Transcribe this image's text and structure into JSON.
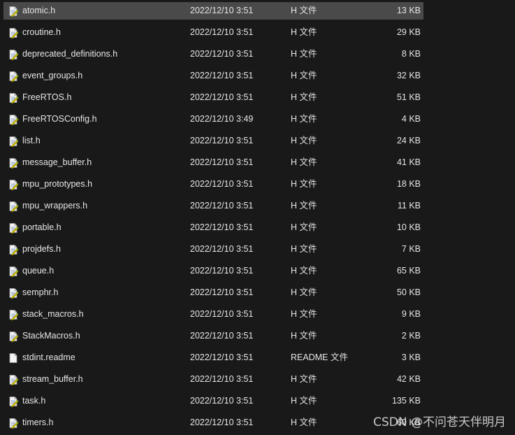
{
  "files": [
    {
      "name": "atomic.h",
      "date": "2022/12/10 3:51",
      "type": "H 文件",
      "size": "13 KB",
      "icon": "h-file-icon",
      "selected": true
    },
    {
      "name": "croutine.h",
      "date": "2022/12/10 3:51",
      "type": "H 文件",
      "size": "29 KB",
      "icon": "h-file-icon"
    },
    {
      "name": "deprecated_definitions.h",
      "date": "2022/12/10 3:51",
      "type": "H 文件",
      "size": "8 KB",
      "icon": "h-file-icon"
    },
    {
      "name": "event_groups.h",
      "date": "2022/12/10 3:51",
      "type": "H 文件",
      "size": "32 KB",
      "icon": "h-file-icon"
    },
    {
      "name": "FreeRTOS.h",
      "date": "2022/12/10 3:51",
      "type": "H 文件",
      "size": "51 KB",
      "icon": "h-file-icon"
    },
    {
      "name": "FreeRTOSConfig.h",
      "date": "2022/12/10 3:49",
      "type": "H 文件",
      "size": "4 KB",
      "icon": "h-file-icon"
    },
    {
      "name": "list.h",
      "date": "2022/12/10 3:51",
      "type": "H 文件",
      "size": "24 KB",
      "icon": "h-file-icon"
    },
    {
      "name": "message_buffer.h",
      "date": "2022/12/10 3:51",
      "type": "H 文件",
      "size": "41 KB",
      "icon": "h-file-icon"
    },
    {
      "name": "mpu_prototypes.h",
      "date": "2022/12/10 3:51",
      "type": "H 文件",
      "size": "18 KB",
      "icon": "h-file-icon"
    },
    {
      "name": "mpu_wrappers.h",
      "date": "2022/12/10 3:51",
      "type": "H 文件",
      "size": "11 KB",
      "icon": "h-file-icon"
    },
    {
      "name": "portable.h",
      "date": "2022/12/10 3:51",
      "type": "H 文件",
      "size": "10 KB",
      "icon": "h-file-icon"
    },
    {
      "name": "projdefs.h",
      "date": "2022/12/10 3:51",
      "type": "H 文件",
      "size": "7 KB",
      "icon": "h-file-icon"
    },
    {
      "name": "queue.h",
      "date": "2022/12/10 3:51",
      "type": "H 文件",
      "size": "65 KB",
      "icon": "h-file-icon"
    },
    {
      "name": "semphr.h",
      "date": "2022/12/10 3:51",
      "type": "H 文件",
      "size": "50 KB",
      "icon": "h-file-icon"
    },
    {
      "name": "stack_macros.h",
      "date": "2022/12/10 3:51",
      "type": "H 文件",
      "size": "9 KB",
      "icon": "h-file-icon"
    },
    {
      "name": "StackMacros.h",
      "date": "2022/12/10 3:51",
      "type": "H 文件",
      "size": "2 KB",
      "icon": "h-file-icon"
    },
    {
      "name": "stdint.readme",
      "date": "2022/12/10 3:51",
      "type": "README 文件",
      "size": "3 KB",
      "icon": "blank-file-icon"
    },
    {
      "name": "stream_buffer.h",
      "date": "2022/12/10 3:51",
      "type": "H 文件",
      "size": "42 KB",
      "icon": "h-file-icon"
    },
    {
      "name": "task.h",
      "date": "2022/12/10 3:51",
      "type": "H 文件",
      "size": "135 KB",
      "icon": "h-file-icon"
    },
    {
      "name": "timers.h",
      "date": "2022/12/10 3:51",
      "type": "H 文件",
      "size": "60 KB",
      "icon": "h-file-icon"
    }
  ],
  "watermark": "CSDN @不问苍天伴明月",
  "colors": {
    "background": "#191919",
    "selected_row": "#4a4a4a",
    "text": "#e6e6e6"
  }
}
